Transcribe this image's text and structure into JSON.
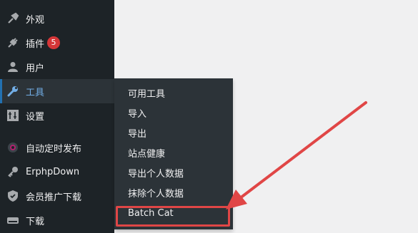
{
  "sidebar": {
    "items": [
      {
        "label": "外观",
        "icon": "paintbrush-icon"
      },
      {
        "label": "插件",
        "icon": "plugin-icon",
        "badge": "5"
      },
      {
        "label": "用户",
        "icon": "user-icon"
      },
      {
        "label": "工具",
        "icon": "wrench-icon",
        "current": true
      },
      {
        "label": "设置",
        "icon": "settings-icon"
      },
      {
        "label": "自动定时发布",
        "icon": "clock-icon"
      },
      {
        "label": "ErphpDown",
        "icon": "key-icon"
      },
      {
        "label": "会员推广下载",
        "icon": "shield-icon"
      },
      {
        "label": "下载",
        "icon": "download-drive-icon"
      }
    ]
  },
  "submenu": {
    "items": [
      {
        "label": "可用工具"
      },
      {
        "label": "导入"
      },
      {
        "label": "导出"
      },
      {
        "label": "站点健康"
      },
      {
        "label": "导出个人数据"
      },
      {
        "label": "抹除个人数据"
      },
      {
        "label": "Batch Cat",
        "highlighted": true
      }
    ]
  },
  "colors": {
    "sidebar_bg": "#1d2327",
    "submenu_bg": "#2c3338",
    "accent": "#72aee6",
    "badge": "#d63638",
    "annotation": "#e04646"
  }
}
